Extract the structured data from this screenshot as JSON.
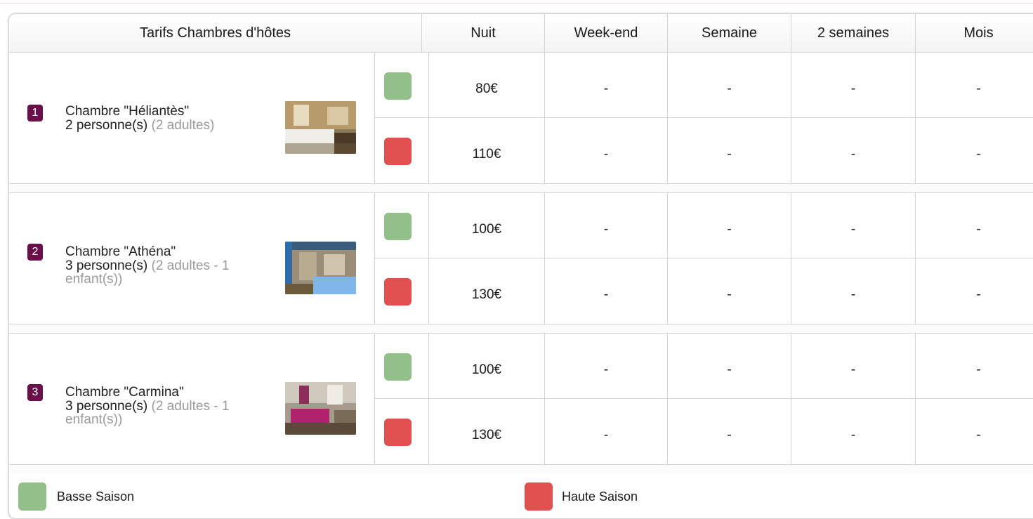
{
  "header": {
    "title": "Tarifs Chambres d'hôtes",
    "columns": [
      "Nuit",
      "Week-end",
      "Semaine",
      "2 semaines",
      "Mois"
    ]
  },
  "rooms": [
    {
      "number": "1",
      "name": "Chambre \"Héliantès\"",
      "capacity": "2 personne(s)",
      "detail": "(2 adultes)",
      "rates": [
        {
          "season": "basse",
          "values": [
            "80€",
            "-",
            "-",
            "-",
            "-"
          ]
        },
        {
          "season": "haute",
          "values": [
            "110€",
            "-",
            "-",
            "-",
            "-"
          ]
        }
      ]
    },
    {
      "number": "2",
      "name": "Chambre \"Athéna\"",
      "capacity": "3 personne(s)",
      "detail": "(2 adultes - 1 enfant(s))",
      "rates": [
        {
          "season": "basse",
          "values": [
            "100€",
            "-",
            "-",
            "-",
            "-"
          ]
        },
        {
          "season": "haute",
          "values": [
            "130€",
            "-",
            "-",
            "-",
            "-"
          ]
        }
      ]
    },
    {
      "number": "3",
      "name": "Chambre \"Carmina\"",
      "capacity": "3 personne(s)",
      "detail": "(2 adultes - 1 enfant(s))",
      "rates": [
        {
          "season": "basse",
          "values": [
            "100€",
            "-",
            "-",
            "-",
            "-"
          ]
        },
        {
          "season": "haute",
          "values": [
            "130€",
            "-",
            "-",
            "-",
            "-"
          ]
        }
      ]
    }
  ],
  "legend": {
    "basse": "Basse Saison",
    "haute": "Haute Saison"
  },
  "colors": {
    "basse": "#93c08a",
    "haute": "#e0504f",
    "badge": "#6b0f4a"
  }
}
